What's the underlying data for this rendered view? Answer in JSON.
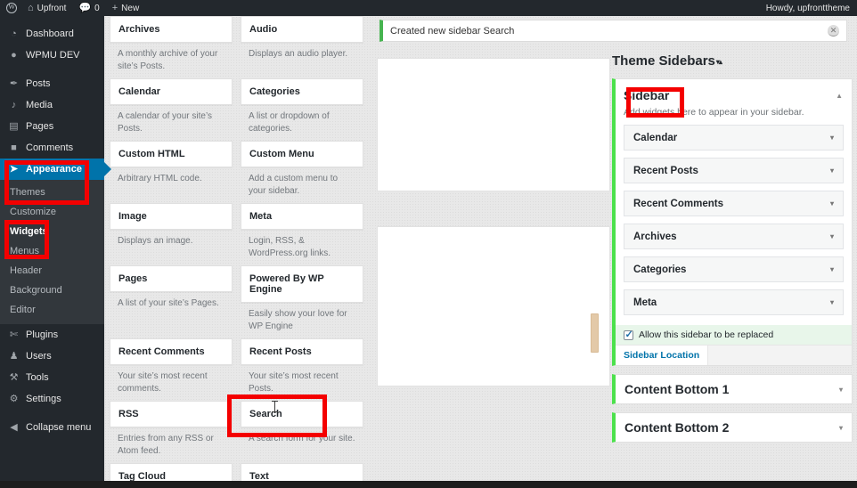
{
  "adminbar": {
    "logo_icon": "wordpress-logo-icon",
    "site_name": "Upfront",
    "home_icon": "home-icon",
    "comments_icon": "comment-bubble-icon",
    "comments_count": "0",
    "plus_icon": "plus-icon",
    "new_label": "New",
    "howdy": "Howdy, upfronttheme"
  },
  "adminmenu": {
    "items": [
      {
        "label": "Dashboard",
        "icon": "dashboard-icon",
        "current": false
      },
      {
        "label": "WPMU DEV",
        "icon": "wpmudev-icon",
        "current": false
      },
      {
        "label": "Posts",
        "icon": "pin-icon",
        "current": false
      },
      {
        "label": "Media",
        "icon": "media-icon",
        "current": false
      },
      {
        "label": "Pages",
        "icon": "page-icon",
        "current": false
      },
      {
        "label": "Comments",
        "icon": "comment-icon",
        "current": false
      },
      {
        "label": "Appearance",
        "icon": "brush-icon",
        "current": true
      }
    ],
    "appearance_submenu": [
      {
        "label": "Themes",
        "active": false
      },
      {
        "label": "Customize",
        "active": false
      },
      {
        "label": "Widgets",
        "active": true
      },
      {
        "label": "Menus",
        "active": false
      },
      {
        "label": "Header",
        "active": false
      },
      {
        "label": "Background",
        "active": false
      },
      {
        "label": "Editor",
        "active": false
      }
    ],
    "items_after": [
      {
        "label": "Plugins",
        "icon": "plug-icon"
      },
      {
        "label": "Users",
        "icon": "user-icon"
      },
      {
        "label": "Tools",
        "icon": "wrench-icon"
      },
      {
        "label": "Settings",
        "icon": "settings-icon"
      },
      {
        "label": "Collapse menu",
        "icon": "collapse-arrow-icon"
      }
    ]
  },
  "notice": {
    "text": "Created new sidebar Search",
    "dismiss_icon": "close-icon",
    "accent_color": "#46b450"
  },
  "available_widgets": [
    {
      "title": "Archives",
      "desc": "A monthly archive of your site’s Posts."
    },
    {
      "title": "Audio",
      "desc": "Displays an audio player."
    },
    {
      "title": "Calendar",
      "desc": "A calendar of your site’s Posts."
    },
    {
      "title": "Categories",
      "desc": "A list or dropdown of categories."
    },
    {
      "title": "Custom HTML",
      "desc": "Arbitrary HTML code."
    },
    {
      "title": "Custom Menu",
      "desc": "Add a custom menu to your sidebar."
    },
    {
      "title": "Image",
      "desc": "Displays an image."
    },
    {
      "title": "Meta",
      "desc": "Login, RSS, & WordPress.org links."
    },
    {
      "title": "Pages",
      "desc": "A list of your site’s Pages."
    },
    {
      "title": "Powered By WP Engine",
      "desc": "Easily show your love for WP Engine"
    },
    {
      "title": "Recent Comments",
      "desc": "Your site’s most recent comments."
    },
    {
      "title": "Recent Posts",
      "desc": "Your site’s most recent Posts."
    },
    {
      "title": "RSS",
      "desc": "Entries from any RSS or Atom feed."
    },
    {
      "title": "Search",
      "desc": "A search form for your site."
    },
    {
      "title": "Tag Cloud",
      "desc": ""
    },
    {
      "title": "Text",
      "desc": ""
    }
  ],
  "theme_sidebars": {
    "title": "Theme Sidebars",
    "carets": "▾▴",
    "sidebar": {
      "name": "Sidebar",
      "description": "Add widgets here to appear in your sidebar.",
      "collapse_icon": "caret-up-icon",
      "widgets": [
        {
          "label": "Calendar",
          "chevron": "▾"
        },
        {
          "label": "Recent Posts",
          "chevron": "▾"
        },
        {
          "label": "Recent Comments",
          "chevron": "▾"
        },
        {
          "label": "Archives",
          "chevron": "▾"
        },
        {
          "label": "Categories",
          "chevron": "▾"
        },
        {
          "label": "Meta",
          "chevron": "▾"
        }
      ],
      "replace_checkbox_label": "Allow this sidebar to be replaced",
      "replace_checked": true,
      "tab_label": "Sidebar Location",
      "accent_color": "#4ce14c"
    },
    "collapsed": [
      {
        "label": "Content Bottom 1",
        "chevron": "▾"
      },
      {
        "label": "Content Bottom 2",
        "chevron": "▾"
      }
    ]
  },
  "annotations": {
    "color": "#f40000",
    "boxes": [
      "appearance-menu",
      "widgets-submenu",
      "search-widget-card",
      "sidebar-panel-title"
    ]
  }
}
